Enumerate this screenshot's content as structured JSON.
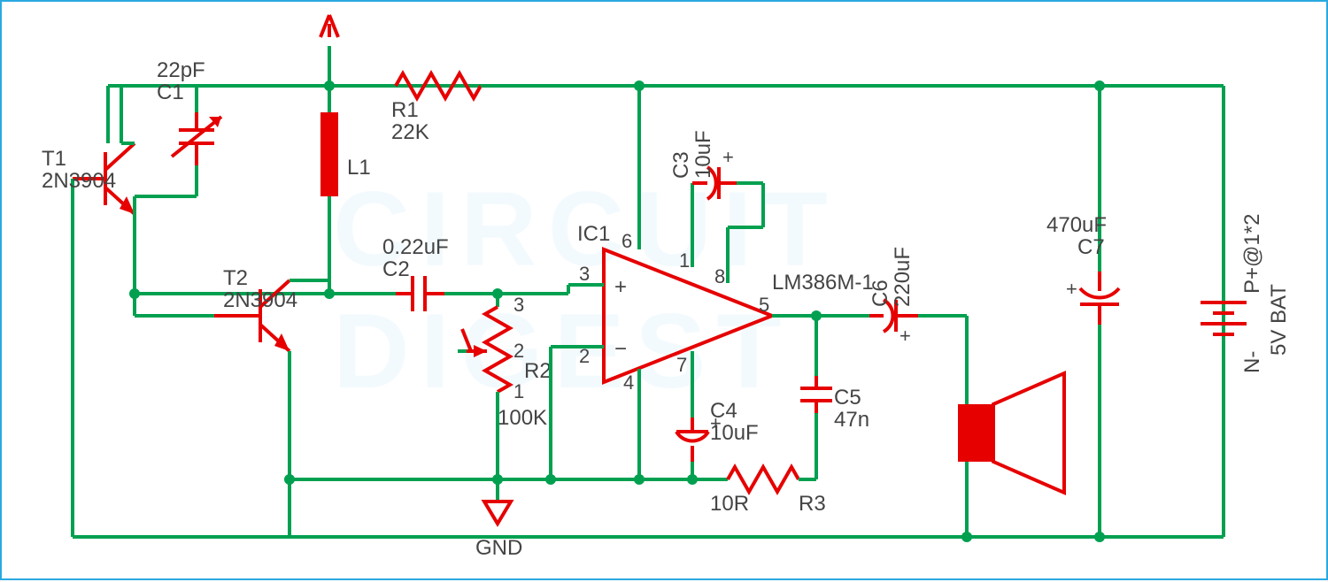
{
  "components": {
    "T1": {
      "ref": "T1",
      "part": "2N3904"
    },
    "T2": {
      "ref": "T2",
      "part": "2N3904"
    },
    "C1": {
      "ref": "C1",
      "value": "22pF"
    },
    "C2": {
      "ref": "C2",
      "value": "0.22uF"
    },
    "C3": {
      "ref": "C3",
      "value": "10uF"
    },
    "C4": {
      "ref": "C4",
      "value": "10uF"
    },
    "C5": {
      "ref": "C5",
      "value": "47n"
    },
    "C6": {
      "ref": "C6",
      "value": "220uF"
    },
    "C7": {
      "ref": "C7",
      "value": "470uF"
    },
    "R1": {
      "ref": "R1",
      "value": "22K"
    },
    "R2": {
      "ref": "R2",
      "value": "100K",
      "pin1": "1",
      "pin2": "2",
      "pin3": "3"
    },
    "R3": {
      "ref": "R3",
      "value": "10R"
    },
    "L1": {
      "ref": "L1"
    },
    "IC1": {
      "ref": "IC1",
      "part": "LM386M-1",
      "pins": {
        "1": "1",
        "2": "2",
        "3": "3",
        "4": "4",
        "5": "5",
        "6": "6",
        "7": "7",
        "8": "8"
      }
    },
    "BAT": {
      "value": "5V BAT",
      "pos": "P+@1*2",
      "neg": "N-"
    }
  },
  "nets": {
    "gnd": "GND"
  },
  "watermark": "CIRCUIT DIGEST"
}
